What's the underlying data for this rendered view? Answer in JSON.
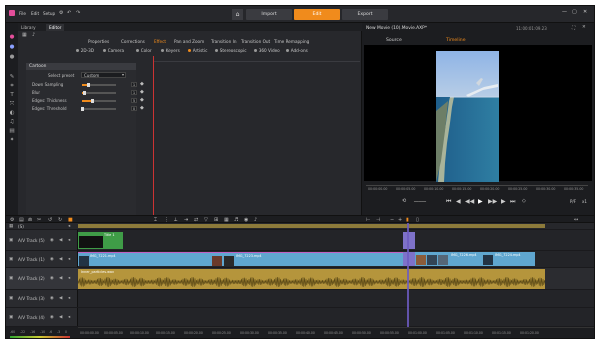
{
  "menu": [
    "File",
    "Edit",
    "Setup"
  ],
  "modes": {
    "import": "Import",
    "edit": "Edit",
    "export": "Export"
  },
  "library": {
    "tab_library": "Library",
    "tab_editor": "Editor"
  },
  "editor_tabs": [
    "Properties",
    "Corrections",
    "Effect",
    "Pan and Zoom",
    "Transition In",
    "Transition Out",
    "Time Remapping"
  ],
  "effect_categories": [
    "2D-3D",
    "Camera",
    "Color",
    "Keyers",
    "Artistic",
    "Stereoscopic",
    "360 Video",
    "Add-ons"
  ],
  "effect_panel": {
    "title": "Cartoon",
    "preset_label": "Select preset",
    "preset_value": "Custom",
    "params": [
      {
        "label": "Down Sampling",
        "value": "1",
        "level": 0.18
      },
      {
        "label": "Blur",
        "value": "1",
        "level": 0.08
      },
      {
        "label": "Edges: Thickness",
        "value": "5",
        "level": 0.3
      },
      {
        "label": "Edges: Threshold",
        "value": "0",
        "level": 0.0
      }
    ]
  },
  "preview": {
    "title": "New Movie (10).Movie.AXP*",
    "timecode": "11:00:01:09.23",
    "tab_source": "Source",
    "tab_timeline": "Timeline",
    "ruler": [
      "00:00:00.00",
      "00:00:05.00",
      "00:00:10.00",
      "00:00:15.00",
      "00:00:20.00",
      "00:00:25.00",
      "00:00:30.00",
      "00:00:35.00"
    ],
    "quality": "P/F",
    "zoom": "x1"
  },
  "tracks": [
    {
      "name": "(S)"
    },
    {
      "name": "A/V Track (5)"
    },
    {
      "name": "A/V Track (1)"
    },
    {
      "name": "A/V Track (2)"
    },
    {
      "name": "A/V Track (3)"
    },
    {
      "name": "A/V Track (4)"
    }
  ],
  "clips": {
    "title_clip": "Title 1",
    "img1": "IMG_7221.mp4",
    "img2": "IMG_7223.mp4",
    "img3": "IMG_7226.mp4",
    "img4": "IMG_7224.mp4",
    "audio": "Inner_particles.wav"
  },
  "bottom_ruler": [
    "00:00:00.00",
    "00:00:05.00",
    "00:00:10.00",
    "00:00:15.00",
    "00:00:20.00",
    "00:00:25.00",
    "00:00:30.00",
    "00:00:35.00",
    "00:00:40.00",
    "00:00:45.00",
    "00:00:50.00",
    "00:00:55.00",
    "00:01:00.00",
    "00:01:05.00",
    "00:01:10.00",
    "00:01:15.00",
    "00:01:20.00"
  ],
  "meter_labels": [
    "-60",
    "-22",
    "-16",
    "-10",
    "-6",
    "-3",
    "0"
  ],
  "colors": {
    "accent": "#f08b1c",
    "clip_blue": "#5fa6cf",
    "clip_gold": "#b5953c",
    "clip_green": "#3f9c47",
    "playhead": "#6d5cc2"
  }
}
